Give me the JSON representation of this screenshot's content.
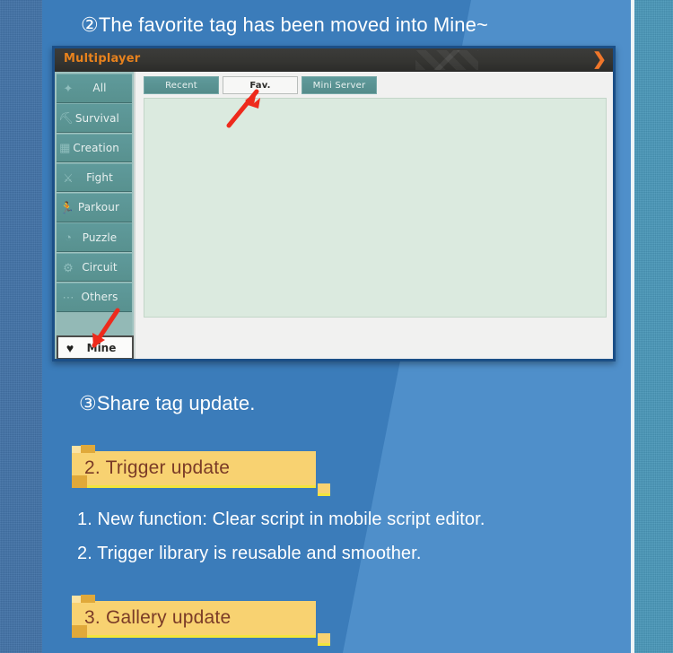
{
  "page": {
    "background_color": "#3b7cba",
    "accent_color": "#4f8fca",
    "banner_color": "#f8d271",
    "banner_text_color": "#7a3b27"
  },
  "captions": {
    "item2": "②The favorite tag has been moved into Mine~",
    "item3": "③Share tag update."
  },
  "game_window": {
    "title": "Multiplayer",
    "close_icon": "❯",
    "sidebar": {
      "items": [
        {
          "label": "All",
          "icon": "sidebar-all-icon",
          "glyph": "✦"
        },
        {
          "label": "Survival",
          "icon": "sidebar-survival-icon",
          "glyph": "⛏"
        },
        {
          "label": "Creation",
          "icon": "sidebar-creation-icon",
          "glyph": "▦"
        },
        {
          "label": "Fight",
          "icon": "sidebar-fight-icon",
          "glyph": "⚔"
        },
        {
          "label": "Parkour",
          "icon": "sidebar-parkour-icon",
          "glyph": "🏃"
        },
        {
          "label": "Puzzle",
          "icon": "sidebar-puzzle-icon",
          "glyph": "◔"
        },
        {
          "label": "Circuit",
          "icon": "sidebar-circuit-icon",
          "glyph": "⚙"
        },
        {
          "label": "Others",
          "icon": "sidebar-others-icon",
          "glyph": "⋯"
        }
      ],
      "mine": {
        "label": "Mine",
        "icon": "heart-icon",
        "glyph": "♥",
        "selected": true
      }
    },
    "tabs": [
      {
        "label": "Recent",
        "active": false
      },
      {
        "label": "Fav.",
        "active": true
      },
      {
        "label": "Mini Server",
        "active": false
      }
    ],
    "content_empty": true
  },
  "annotations": {
    "arrow_to_fav_tab": "red-arrow-icon",
    "arrow_to_mine_button": "red-arrow-icon"
  },
  "sections": [
    {
      "heading": "2. Trigger update",
      "items": [
        "1. New function: Clear script in mobile script editor.",
        "2. Trigger library is reusable and smoother."
      ]
    },
    {
      "heading": "3. Gallery update",
      "items": []
    }
  ]
}
